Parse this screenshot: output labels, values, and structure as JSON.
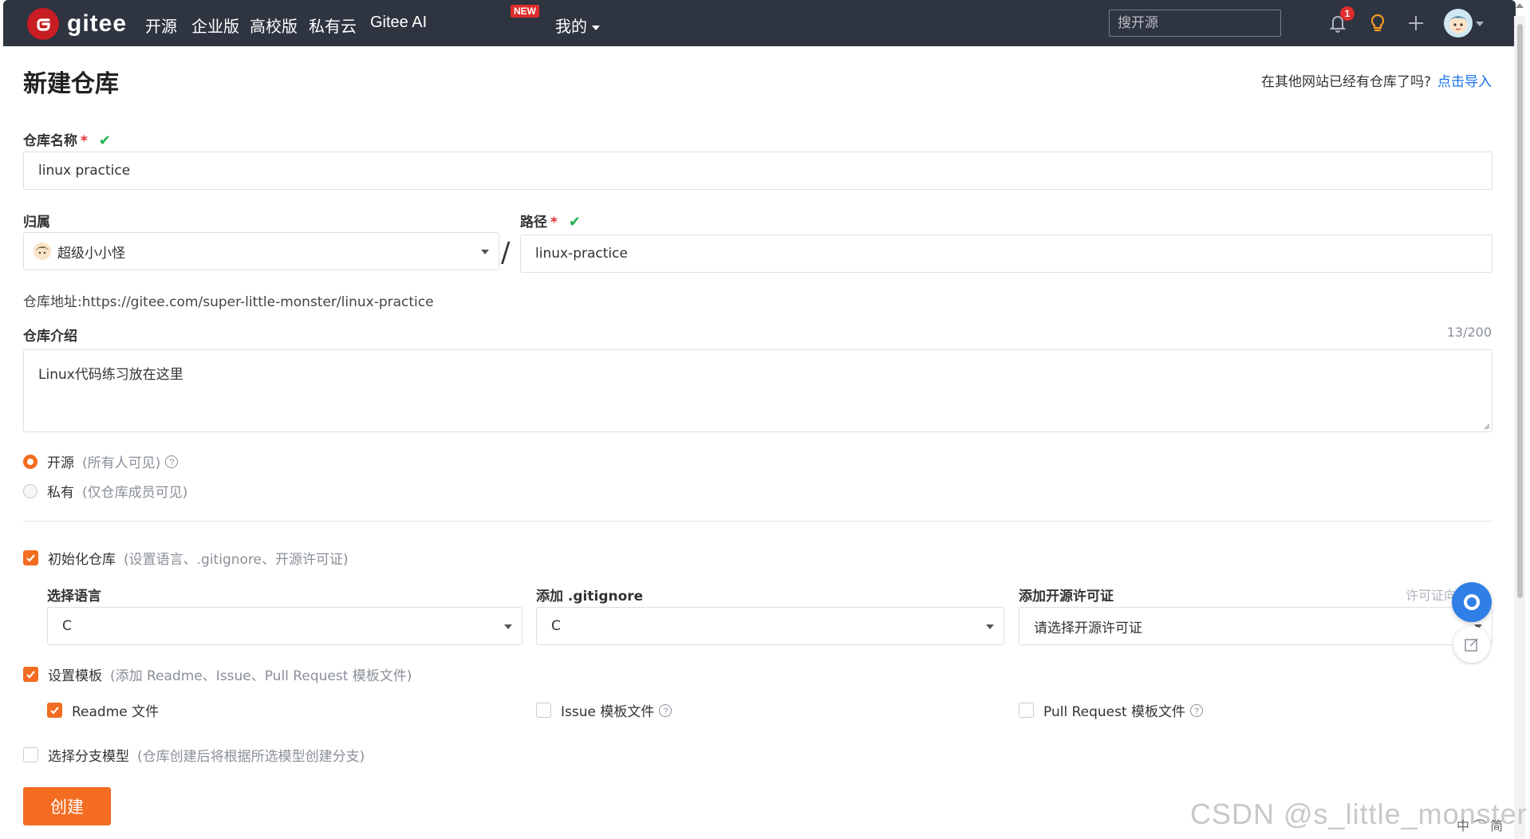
{
  "navbar": {
    "logo_text": "gitee",
    "items": [
      "开源",
      "企业版",
      "高校版",
      "私有云",
      "Gitee AI"
    ],
    "new_badge": "NEW",
    "mine_label": "我的",
    "search_placeholder": "搜开源",
    "notification_count": "1"
  },
  "page": {
    "title": "新建仓库",
    "import_prompt": "在其他网站已经有仓库了吗?",
    "import_link": "点击导入"
  },
  "form": {
    "repo_name_label": "仓库名称",
    "required_mark": "*",
    "repo_name_value": "linux practice",
    "owner_label": "归属",
    "owner_value": "超级小小怪",
    "path_label": "路径",
    "path_value": "linux-practice",
    "slash": "/",
    "repo_address_label": "仓库地址:",
    "repo_address_value": "https://gitee.com/super-little-monster/linux-practice",
    "intro_label": "仓库介绍",
    "intro_counter": "13/200",
    "intro_value": "Linux代码练习放在这里",
    "visibility": {
      "public_label": "开源",
      "public_hint": "(所有人可见)",
      "private_label": "私有",
      "private_hint": "(仅仓库成员可见)",
      "selected": "public"
    },
    "init_repo": {
      "label": "初始化仓库",
      "hint": "(设置语言、.gitignore、开源许可证)",
      "checked": true,
      "language_label": "选择语言",
      "language_value": "C",
      "gitignore_label": "添加 .gitignore",
      "gitignore_value": "C",
      "license_label": "添加开源许可证",
      "license_placeholder": "请选择开源许可证",
      "license_hint": "许可证向导"
    },
    "templates": {
      "label": "设置模板",
      "hint": "(添加 Readme、Issue、Pull Request 模板文件)",
      "checked": true,
      "readme_label": "Readme 文件",
      "readme_checked": true,
      "issue_label": "Issue 模板文件",
      "issue_checked": false,
      "pr_label": "Pull Request 模板文件",
      "pr_checked": false
    },
    "branch_model": {
      "label": "选择分支模型",
      "hint": "(仓库创建后将根据所选模型创建分支)",
      "checked": false
    },
    "create_button": "创建",
    "help_glyph": "?"
  },
  "overlay": {
    "watermark": "CSDN @s_little_monster",
    "ime_text": "中 ⌒ 简"
  },
  "colors": {
    "navbar_bg": "#2e3440",
    "accent_orange": "#f36c21",
    "link_blue": "#1a73e8",
    "success_green": "#21b351",
    "required_red": "#e02c2c"
  }
}
